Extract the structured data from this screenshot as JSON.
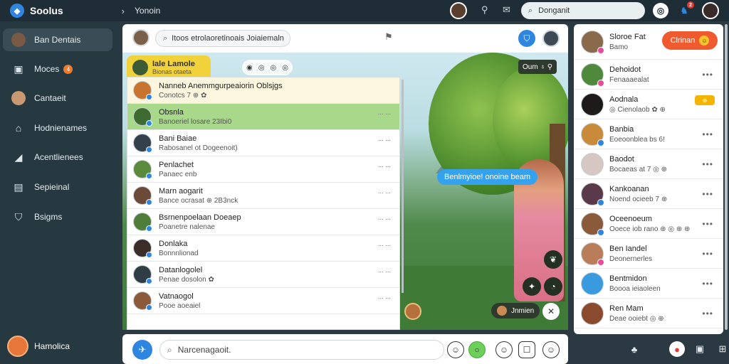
{
  "app": {
    "title": "Soolus",
    "breadcrumb": "Yonoin"
  },
  "top": {
    "search_text": "Donganit",
    "badge_count": "2",
    "icons": [
      "chevron-right-icon",
      "pin-icon",
      "chat-icon",
      "search-icon",
      "timer-icon",
      "bell-icon"
    ]
  },
  "sidebar": {
    "items": [
      {
        "label": "Ban Dentais",
        "icon": "avatar",
        "active": true
      },
      {
        "label": "Moces",
        "icon": "camera-icon",
        "badge": "4"
      },
      {
        "label": "Cantaeit",
        "icon": "contact-icon"
      },
      {
        "label": "Hodnienames",
        "icon": "home-icon"
      },
      {
        "label": "Acentlienees",
        "icon": "share-icon"
      },
      {
        "label": "Sepieinal",
        "icon": "file-icon"
      },
      {
        "label": "Bsigms",
        "icon": "shield-icon"
      }
    ],
    "user": {
      "name": "Hamolica"
    }
  },
  "mid_header": {
    "search_text": "Itoos etrolaoretinoais Joiaiemaln"
  },
  "scene": {
    "speech": "Benlmyioe! onoine beam",
    "control": "Oum ♁ ⚲",
    "pill_label": "Jnmien"
  },
  "chat_tab": {
    "title": "Iale Lamole",
    "subtitle": "Bionas otaeta"
  },
  "chats": [
    {
      "name": "Nanneb Anemmgurpeaiorin Oblsjgs",
      "sub": "Conotcs 7 ⊕ ✿",
      "time": "",
      "style": "cream",
      "color": "#c9742e"
    },
    {
      "name": "Obsnla",
      "sub": "Banoeriel losare 23Ibi0",
      "time": "⋯ ⋯",
      "style": "green",
      "color": "#3d6b32"
    },
    {
      "name": "Bani Baiae",
      "sub": "Rabosanel ot Dogeenoit)",
      "time": "⋯ ⋯",
      "style": "",
      "color": "#34414a"
    },
    {
      "name": "Penlachet",
      "sub": "Panaec enb",
      "time": "⋯ ⋯",
      "style": "",
      "color": "#5a8a3c"
    },
    {
      "name": "Marn aogarit",
      "sub": "Bance ocrasat ⊕ 2B3nck",
      "time": "⋯ ⋯",
      "style": "",
      "color": "#6b4a38"
    },
    {
      "name": "Bsrnenpoelaan Doeaep",
      "sub": "Poanetre nalenae",
      "time": "⋯ ⋯",
      "style": "",
      "color": "#4f7d3a"
    },
    {
      "name": "Donlaka",
      "sub": "Bonnnlionad",
      "time": "⋯ ⋯",
      "style": "",
      "color": "#3b2e2a"
    },
    {
      "name": "Datanlogolel",
      "sub": "Penae dosolon ✿",
      "time": "⋯ ⋯",
      "style": "",
      "color": "#2f3d44"
    },
    {
      "name": "Vatnaogol",
      "sub": "Pooe aoeaiel",
      "time": "⋯ ⋯",
      "style": "",
      "color": "#8a5a3a"
    }
  ],
  "composer": {
    "placeholder": "Narcenagaoit."
  },
  "right": {
    "top_name": "Sloroe Fat",
    "top_sub": "Bamo",
    "orange_label": "Clrinan",
    "rows": [
      {
        "name": "Dehoidot",
        "sub": "Fenaaaealat",
        "color": "#4f8a3c",
        "dot": "pink"
      },
      {
        "name": "Aodnala",
        "sub": "◎ Cienolaob ✿ ⊕",
        "color": "#1f1a1a",
        "dot": "",
        "pill": "⊕"
      },
      {
        "name": "Banbia",
        "sub": "Eoeoonblea bs 6!",
        "color": "#c98a3a",
        "dot": "blue"
      },
      {
        "name": "Baodot",
        "sub": "Bocaeas at 7 ◎ ⊕",
        "color": "#d7c7c2",
        "dot": ""
      },
      {
        "name": "Kankoanan",
        "sub": "Noend ocieeb 7 ⊕",
        "color": "#5a3a4a",
        "dot": "blue"
      },
      {
        "name": "Oceenoeum",
        "sub": "Ooece iob rano ⊕ ◎ ⊕ ⊕",
        "color": "#8a5a3a",
        "dot": "blue"
      },
      {
        "name": "Ben Iandel",
        "sub": "Deonernerles",
        "color": "#b97d5a",
        "dot": "pink"
      },
      {
        "name": "Bentmidon",
        "sub": "Boooa ieiaoleen",
        "color": "#3a9ae0",
        "dot": ""
      },
      {
        "name": "Ren Mam",
        "sub": "Deae ooiebt ◎ ⊕",
        "color": "#8a4a2e",
        "dot": ""
      }
    ]
  }
}
